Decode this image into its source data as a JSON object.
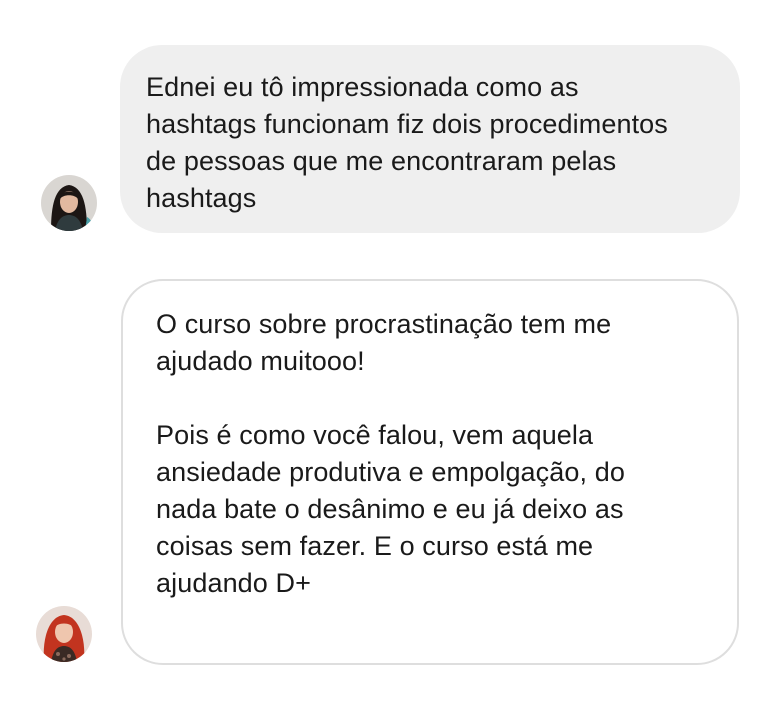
{
  "conversation": {
    "messages": [
      {
        "sender_avatar": "avatar-woman-dark-hair",
        "style": "gray",
        "paragraphs": [
          "Ednei eu tô impressionada como as\nhashtags funcionam fiz dois procedimentos\nde pessoas que me encontraram pelas\nhashtags"
        ]
      },
      {
        "sender_avatar": "avatar-woman-red-hair",
        "style": "outlined",
        "paragraphs": [
          "O curso sobre procrastinação tem me\najudado muitooo!",
          "Pois é como você falou, vem aquela\nansiedade produtiva e empolgação, do\nnada bate o desânimo e eu já deixo as\ncoisas sem fazer. E o curso está me\najudando D+"
        ]
      }
    ]
  },
  "colors": {
    "gray_bubble": "#efefef",
    "outline_border": "#dedede",
    "text": "#1a1a1a"
  }
}
